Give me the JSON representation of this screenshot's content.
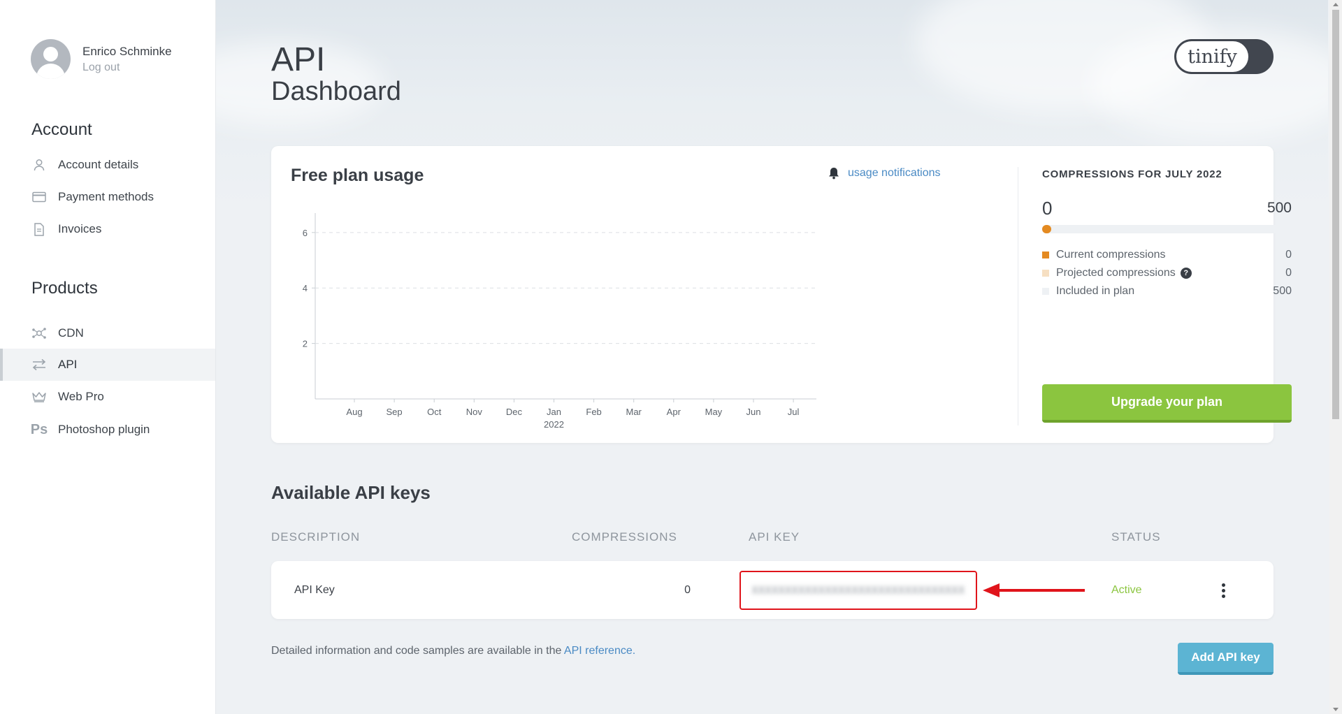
{
  "user": {
    "name": "Enrico Schminke",
    "logout_label": "Log out"
  },
  "sidebar": {
    "account_title": "Account",
    "account_items": [
      {
        "label": "Account details",
        "icon": "user-icon"
      },
      {
        "label": "Payment methods",
        "icon": "credit-card-icon"
      },
      {
        "label": "Invoices",
        "icon": "document-icon"
      }
    ],
    "products_title": "Products",
    "product_items": [
      {
        "label": "CDN",
        "icon": "network-icon"
      },
      {
        "label": "API",
        "icon": "arrows-icon",
        "active": true
      },
      {
        "label": "Web Pro",
        "icon": "crown-icon"
      },
      {
        "label": "Photoshop plugin",
        "icon": "photoshop-icon",
        "icon_text": "Ps"
      }
    ]
  },
  "page": {
    "title": "API",
    "subtitle": "Dashboard"
  },
  "logo": {
    "text": "tinify"
  },
  "usage": {
    "title": "Free plan usage",
    "notifications_label": "usage notifications",
    "compressions_title": "COMPRESSIONS FOR JULY 2022",
    "range_min": "0",
    "range_max": "500",
    "progress_fraction": 0,
    "legend": [
      {
        "label": "Current compressions",
        "value": "0",
        "color": "#e48a21"
      },
      {
        "label": "Projected compressions",
        "value": "0",
        "color": "#f6dfc2"
      },
      {
        "label": "Included in plan",
        "value": "500",
        "color": "#eef1f4"
      }
    ],
    "help_glyph": "?",
    "upgrade_label": "Upgrade your plan"
  },
  "chart_data": {
    "type": "bar",
    "categories": [
      "Aug",
      "Sep",
      "Oct",
      "Nov",
      "Dec",
      "Jan",
      "Feb",
      "Mar",
      "Apr",
      "May",
      "Jun",
      "Jul"
    ],
    "year_label": "2022",
    "values": [
      0,
      0,
      0,
      0,
      0,
      0,
      0,
      0,
      0,
      0,
      0,
      0
    ],
    "y_ticks": [
      2,
      4,
      6
    ],
    "ylim": [
      0,
      6.6
    ],
    "grid": true,
    "title": "",
    "xlabel": "",
    "ylabel": ""
  },
  "keys": {
    "title": "Available API keys",
    "columns": [
      "DESCRIPTION",
      "COMPRESSIONS",
      "API KEY",
      "STATUS"
    ],
    "rows": [
      {
        "description": "API Key",
        "compressions": "0",
        "api_key": "XXXXXXXXXXXXXXXXXXXXXXXXXXXXXXXX",
        "status": "Active"
      }
    ],
    "footnote_text": "Detailed information and code samples are available in the ",
    "footnote_link": "API reference.",
    "add_label": "Add API key",
    "status_color": "#8bc53f",
    "highlight_color": "#e0141b"
  }
}
